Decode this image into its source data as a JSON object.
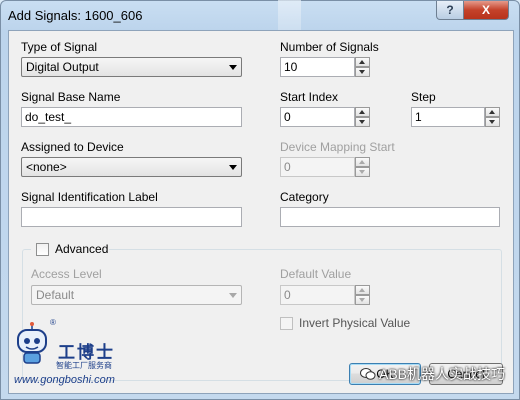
{
  "window": {
    "title": "Add Signals: 1600_606",
    "help_glyph": "?",
    "close_glyph": "X"
  },
  "form": {
    "type_of_signal": {
      "label": "Type of Signal",
      "value": "Digital Output"
    },
    "number_of_signals": {
      "label": "Number of Signals",
      "value": "10"
    },
    "signal_base_name": {
      "label": "Signal Base Name",
      "value": "do_test_"
    },
    "start_index": {
      "label": "Start Index",
      "value": "0"
    },
    "step": {
      "label": "Step",
      "value": "1"
    },
    "assigned_to_device": {
      "label": "Assigned to Device",
      "value": "<none>"
    },
    "device_mapping_start": {
      "label": "Device Mapping Start",
      "value": "0"
    },
    "signal_identification_label": {
      "label": "Signal Identification Label",
      "value": ""
    },
    "category": {
      "label": "Category",
      "value": ""
    }
  },
  "advanced": {
    "label": "Advanced",
    "checked": false,
    "access_level": {
      "label": "Access Level",
      "value": "Default"
    },
    "default_value": {
      "label": "Default Value",
      "value": "0"
    },
    "invert_physical_value": {
      "label": "Invert Physical Value",
      "checked": false
    }
  },
  "buttons": {
    "ok_label": "OK",
    "cancel_label": "Cancel"
  },
  "watermark": {
    "brand": "工博士",
    "subtitle": "智能工厂服务商",
    "url": "www.gongboshi.com",
    "registered": "®",
    "right_text": "ABB机器人实战技巧"
  },
  "colors": {
    "title_bar": "#c4d9ee",
    "close_button": "#c4422a",
    "dialog_bg": "#f0f0f0",
    "watermark_blue": "#1d3f8a"
  }
}
